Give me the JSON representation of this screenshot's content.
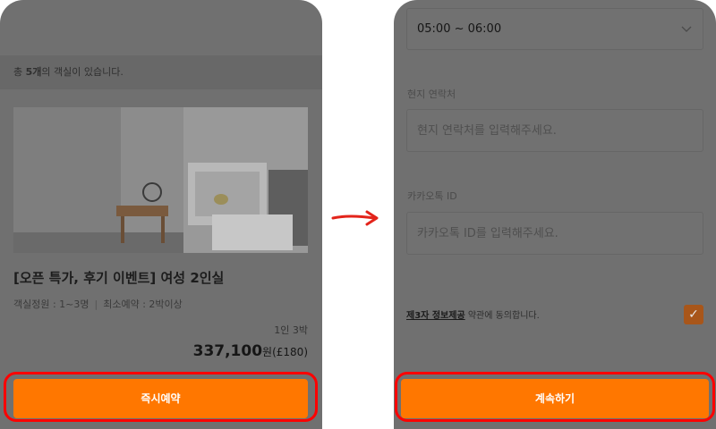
{
  "left_screen": {
    "room_count": {
      "prefix": "총 ",
      "count": "5개",
      "suffix": "의 객실이 있습니다."
    },
    "room": {
      "title": "[오픈 특가, 후기 이벤트] 여성 2인실",
      "capacity": "객실정원 : 1~3명",
      "separator": "|",
      "min_booking": "최소예약 : 2박이상",
      "stay": "1인 3박",
      "price": "337,100",
      "price_unit": "원",
      "price_gbp": "(£180)"
    },
    "cta_label": "즉시예약"
  },
  "right_screen": {
    "time_select": {
      "value": "05:00 ~ 06:00",
      "icon": "chevron-down-icon"
    },
    "local_contact": {
      "label": "현지 연락처",
      "placeholder": "현지 연락처를 입력해주세요."
    },
    "kakao": {
      "label": "카카오톡 ID",
      "placeholder": "카카오톡 ID를 입력해주세요."
    },
    "consent": {
      "link": "제3자 정보제공",
      "text": " 약관에 동의합니다.",
      "checked": true
    },
    "cta_label": "계속하기"
  },
  "colors": {
    "accent": "#ff7700",
    "highlight": "#ff0000",
    "overlay": "#707070"
  }
}
